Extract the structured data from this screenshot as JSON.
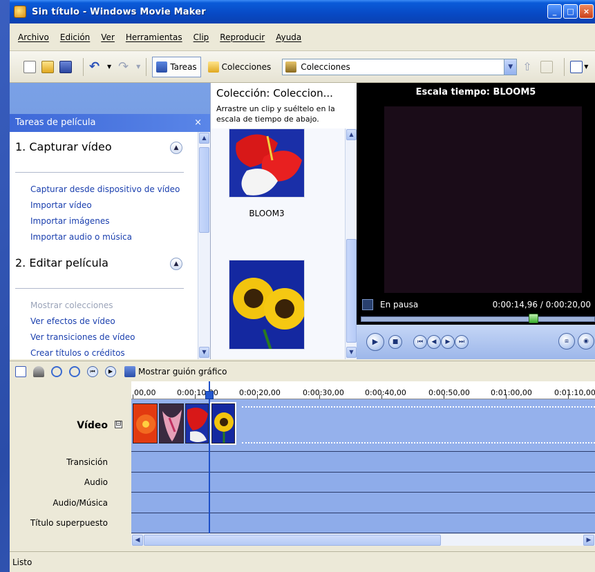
{
  "window": {
    "title": "Sin título - Windows Movie Maker"
  },
  "menu": [
    "Archivo",
    "Edición",
    "Ver",
    "Herramientas",
    "Clip",
    "Reproducir",
    "Ayuda"
  ],
  "toolbar": {
    "tasks_label": "Tareas",
    "collections_label": "Colecciones",
    "combo_value": "Colecciones"
  },
  "tasks": {
    "header": "Tareas de película",
    "close_glyph": "×",
    "section1_title": "1. Capturar vídeo",
    "section1_links": [
      "Capturar desde dispositivo de vídeo",
      "Importar vídeo",
      "Importar imágenes",
      "Importar audio o música"
    ],
    "section2_title": "2. Editar película",
    "section2_links": [
      "Mostrar colecciones",
      "Ver efectos de vídeo",
      "Ver transiciones de vídeo",
      "Crear títulos o créditos"
    ]
  },
  "collection": {
    "title": "Colección: Coleccion...",
    "hint": "Arrastre un clip y suéltelo en la escala de tiempo de abajo.",
    "items": [
      {
        "label": "BLOOM3"
      }
    ]
  },
  "preview": {
    "title": "Escala tiempo: BLOOM5",
    "state": "En pausa",
    "time": "0:00:14,96 / 0:00:20,00",
    "progress": 0.748
  },
  "timeline": {
    "storyboard_label": "Mostrar guión gráfico",
    "ruler": [
      "00,00",
      "0:00:10,00",
      "0:00:20,00",
      "0:00:30,00",
      "0:00:40,00",
      "0:00:50,00",
      "0:01:00,00",
      "0:01:10,00"
    ],
    "tracks": {
      "video": "Vídeo",
      "transition": "Transición",
      "audio": "Audio",
      "music": "Audio/Música",
      "title_overlay": "Título superpuesto"
    },
    "collapse_glyph": "⊟"
  },
  "status": {
    "text": "Listo"
  },
  "colors": {
    "titlebar": "#0849c4",
    "link": "#1a3fae",
    "track": "#8eacea"
  }
}
